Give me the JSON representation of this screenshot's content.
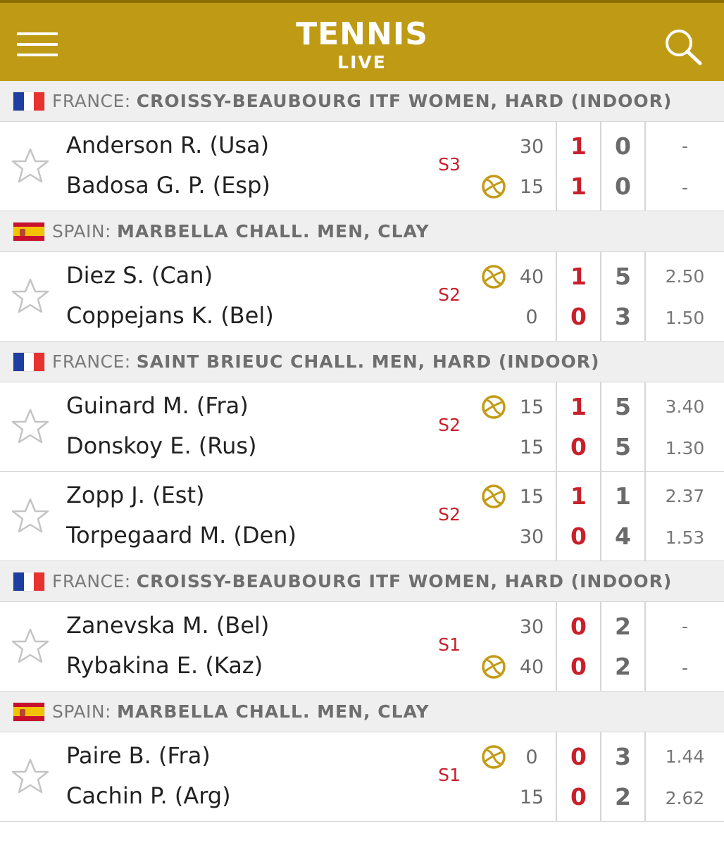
{
  "header": {
    "title": "TENNIS",
    "subtitle": "LIVE",
    "bg_color": "#bf9b15",
    "menu_icon": "hamburger-menu-icon",
    "search_icon": "search-icon"
  },
  "colors": {
    "accent_red": "#c8202a",
    "serve_ball": "#c49b16"
  },
  "sections": [
    {
      "flag": "fr",
      "country": "FRANCE:",
      "league": "CROISSY-BEAUBOURG ITF WOMEN, HARD (INDOOR)",
      "matches": [
        {
          "set": "S3",
          "server": 2,
          "p1": {
            "name": "Anderson R. (Usa)",
            "game": "30",
            "sets": "1",
            "games": "0",
            "odds": "-"
          },
          "p2": {
            "name": "Badosa G. P. (Esp)",
            "game": "15",
            "sets": "1",
            "games": "0",
            "odds": "-"
          }
        }
      ]
    },
    {
      "flag": "es",
      "country": "SPAIN:",
      "league": "MARBELLA CHALL. MEN, CLAY",
      "matches": [
        {
          "set": "S2",
          "server": 1,
          "p1": {
            "name": "Diez S. (Can)",
            "game": "40",
            "sets": "1",
            "games": "5",
            "odds": "2.50"
          },
          "p2": {
            "name": "Coppejans K. (Bel)",
            "game": "0",
            "sets": "0",
            "games": "3",
            "odds": "1.50"
          }
        }
      ]
    },
    {
      "flag": "fr",
      "country": "FRANCE:",
      "league": "SAINT BRIEUC CHALL. MEN, HARD (INDOOR)",
      "matches": [
        {
          "set": "S2",
          "server": 1,
          "p1": {
            "name": "Guinard M. (Fra)",
            "game": "15",
            "sets": "1",
            "games": "5",
            "odds": "3.40"
          },
          "p2": {
            "name": "Donskoy E. (Rus)",
            "game": "15",
            "sets": "0",
            "games": "5",
            "odds": "1.30"
          }
        },
        {
          "set": "S2",
          "server": 1,
          "p1": {
            "name": "Zopp J. (Est)",
            "game": "15",
            "sets": "1",
            "games": "1",
            "odds": "2.37"
          },
          "p2": {
            "name": "Torpegaard M. (Den)",
            "game": "30",
            "sets": "0",
            "games": "4",
            "odds": "1.53"
          }
        }
      ]
    },
    {
      "flag": "fr",
      "country": "FRANCE:",
      "league": "CROISSY-BEAUBOURG ITF WOMEN, HARD (INDOOR)",
      "matches": [
        {
          "set": "S1",
          "server": 2,
          "p1": {
            "name": "Zanevska M. (Bel)",
            "game": "30",
            "sets": "0",
            "games": "2",
            "odds": "-"
          },
          "p2": {
            "name": "Rybakina E. (Kaz)",
            "game": "40",
            "sets": "0",
            "games": "2",
            "odds": "-"
          }
        }
      ]
    },
    {
      "flag": "es",
      "country": "SPAIN:",
      "league": "MARBELLA CHALL. MEN, CLAY",
      "matches": [
        {
          "set": "S1",
          "server": 1,
          "p1": {
            "name": "Paire B. (Fra)",
            "game": "0",
            "sets": "0",
            "games": "3",
            "odds": "1.44"
          },
          "p2": {
            "name": "Cachin P. (Arg)",
            "game": "15",
            "sets": "0",
            "games": "2",
            "odds": "2.62"
          }
        }
      ]
    }
  ]
}
